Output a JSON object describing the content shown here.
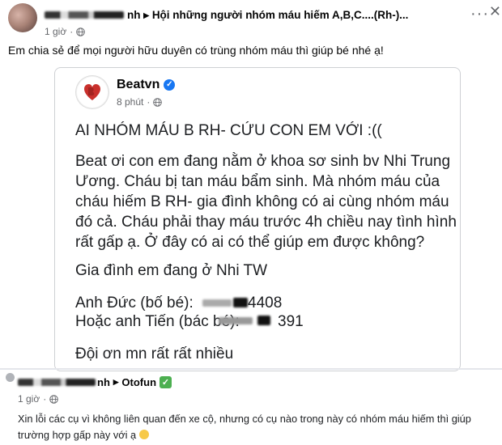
{
  "top_post": {
    "group_name": "Hội những người nhóm máu hiếm A,B,C....(Rh-)...",
    "name_suffix": "nh",
    "separator": "▸",
    "time": "1 giờ",
    "more": "···",
    "close": "✕",
    "text": "Em chia sẻ để mọi người hữu duyên có trùng nhóm máu thì giúp bé nhé ạ!"
  },
  "shared_post": {
    "page_name": "Beatvn",
    "time": "8 phút",
    "lines": [
      "AI NHÓM MÁU B RH- CỨU CON EM VỚI :((",
      "Beat ơi con em đang nằm ở khoa sơ sinh bv Nhi Trung",
      "Ương. Cháu bị tan máu bẩm sinh. Mà nhóm máu của",
      "cháu hiếm B RH- gia đình không có ai cùng nhóm máu",
      "đó cả. Cháu phải thay máu trước 4h chiều nay tình hình",
      "rất gấp ạ. Ở đây có ai có thể giúp em được không?",
      "Gia đình em đang ở Nhi TW",
      "Anh Đức (bố bé):",
      "4408",
      "Hoặc anh Tiến (bác bé):",
      "391",
      "Đội ơn mn rất rất nhiều"
    ]
  },
  "bottom_post": {
    "name_suffix": "nh",
    "separator": "▸",
    "group_name": "Otofun",
    "time": "1 giờ",
    "text": "Xin lỗi các cụ vì không liên quan đến xe cộ, nhưng có cụ nào trong này có nhóm máu hiếm thì giúp trường hợp gấp này với ạ"
  }
}
